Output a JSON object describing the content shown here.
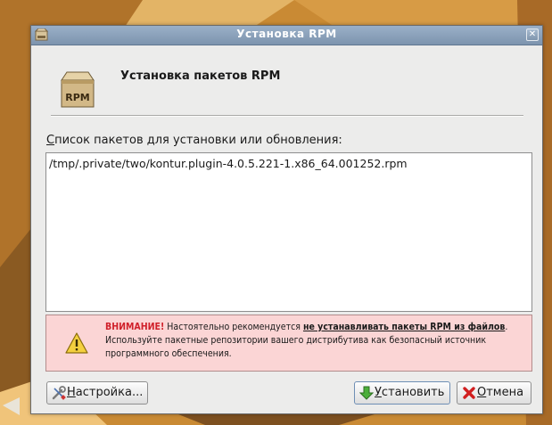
{
  "window": {
    "title": "Установка RPM",
    "close_glyph": "✕"
  },
  "header": {
    "icon_label": "RPM",
    "title": "Установка пакетов RPM"
  },
  "package_list": {
    "label_mnemonic": "С",
    "label_rest": "писок пакетов для установки или обновления:",
    "items": [
      "/tmp/.private/two/kontur.plugin-4.0.5.221-1.x86_64.001252.rpm"
    ]
  },
  "warning": {
    "strong": "ВНИМАНИЕ!",
    "text_before": " Настоятельно рекомендуется ",
    "link_text": "не устанавливать пакеты RPM из файлов",
    "text_after": ". Используйте пакетные репозитории вашего дистрибутива как безопасный источник программного обеспечения.",
    "background_color": "#fbd5d5",
    "emphasis_color": "#d0202a"
  },
  "buttons": {
    "settings": {
      "mnemonic": "Н",
      "rest": "астройка...",
      "icon": "wrench-screwdriver-icon"
    },
    "install": {
      "mnemonic": "У",
      "rest": "становить",
      "icon": "green-arrow-down-icon"
    },
    "cancel": {
      "mnemonic": "О",
      "rest": "тмена",
      "icon": "red-x-icon"
    }
  },
  "colors": {
    "titlebar": "#8aa1ba",
    "dialog_bg": "#ececeb",
    "desktop": "#c98a34"
  }
}
